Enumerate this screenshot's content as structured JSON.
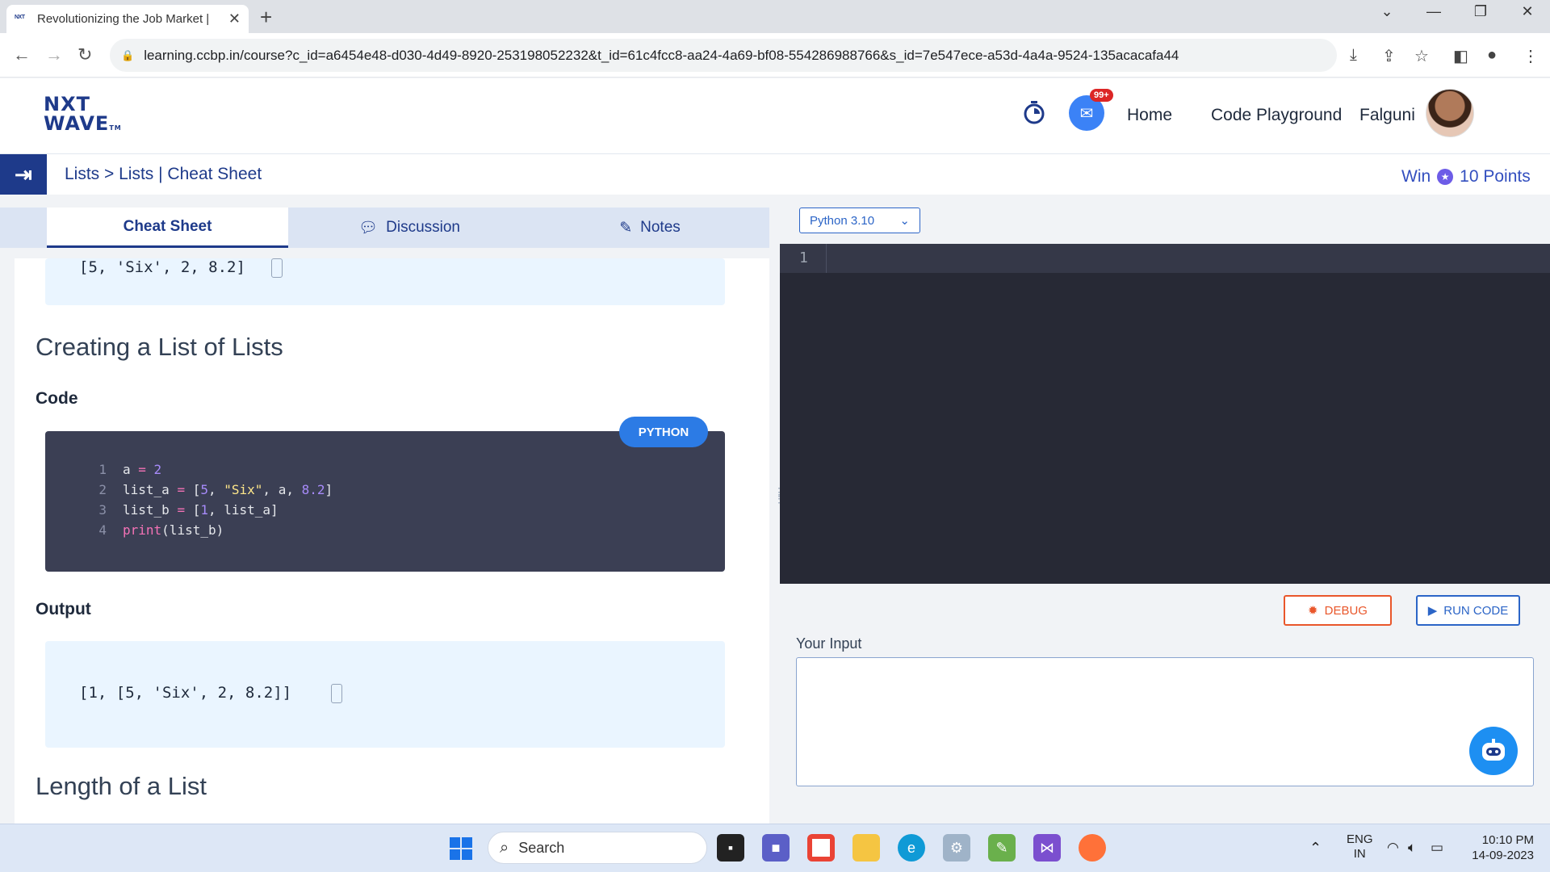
{
  "browser": {
    "tab_title": "Revolutionizing the Job Market |",
    "url": "learning.ccbp.in/course?c_id=a6454e48-d030-4d49-8920-253198052232&t_id=61c4fcc8-aa24-4a69-bf08-554286988766&s_id=7e547ece-a53d-4a4a-9524-135acacafa44"
  },
  "header": {
    "logo_line1": "NXT",
    "logo_line2": "WAVE",
    "logo_tm": "TM",
    "badge": "99+",
    "home": "Home",
    "code_playground": "Code Playground",
    "user": "Falguni"
  },
  "breadcrumb": "Lists > Lists | Cheat Sheet",
  "reward": {
    "prefix": "Win",
    "points": "10 Points"
  },
  "tabs": [
    {
      "label": "Cheat Sheet",
      "icon": "none"
    },
    {
      "label": "Discussion",
      "icon": "chat-bubble-icon"
    },
    {
      "label": "Notes",
      "icon": "notes-icon"
    }
  ],
  "content": {
    "prev_output": "[5, 'Six', 2, 8.2]",
    "heading1": "Creating a List of Lists",
    "code_label": "Code",
    "lang_badge": "PYTHON",
    "code_lines": [
      {
        "n": "1",
        "text": "a = 2"
      },
      {
        "n": "2",
        "text": "list_a = [5, \"Six\", a, 8.2]"
      },
      {
        "n": "3",
        "text": "list_b = [1, list_a]"
      },
      {
        "n": "4",
        "text": "print(list_b)"
      }
    ],
    "output_label": "Output",
    "output": "[1, [5, 'Six', 2, 8.2]]",
    "heading2": "Length of a List"
  },
  "editor": {
    "language": "Python 3.10",
    "line_number": "1",
    "debug": "DEBUG",
    "run": "RUN CODE",
    "input_label": "Your Input",
    "input_value": ""
  },
  "taskbar": {
    "search": "Search",
    "lang1": "ENG",
    "lang2": "IN",
    "time": "10:10 PM",
    "date": "14-09-2023"
  }
}
